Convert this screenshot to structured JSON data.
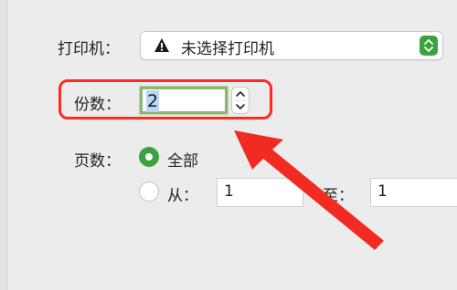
{
  "printer": {
    "label": "打印机：",
    "selected": "未选择打印机",
    "warning_icon": "warning-icon",
    "accent": "#3aa33f"
  },
  "copies": {
    "label": "份数：",
    "value": "2"
  },
  "pages": {
    "label": "页数：",
    "option_all": "全部",
    "option_from": "从：",
    "from_value": "1",
    "to_label": "至：",
    "to_value": "1"
  },
  "annotation": {
    "highlight_color": "#ff2a22"
  }
}
